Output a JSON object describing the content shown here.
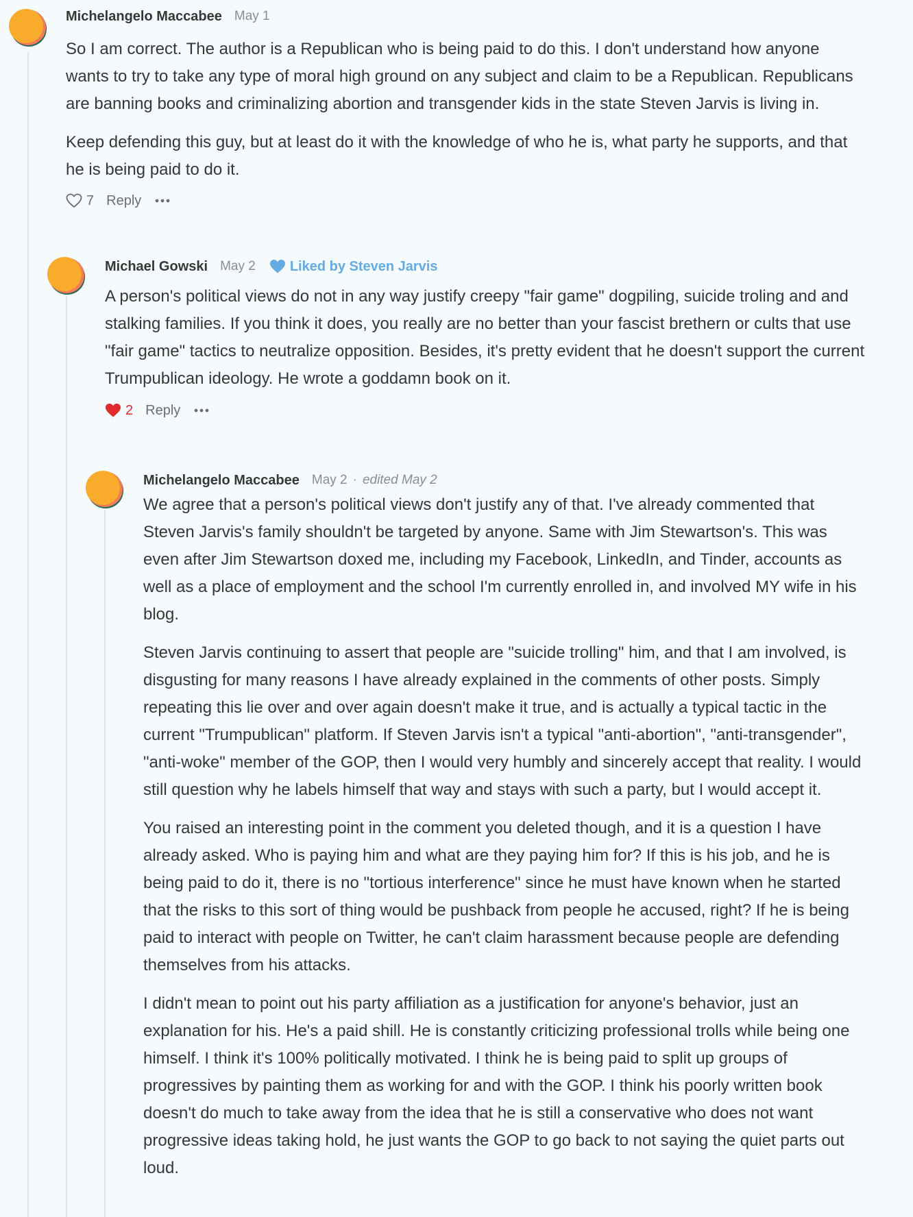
{
  "comments": [
    {
      "author": "Michelangelo Maccabee",
      "date": "May 1",
      "paragraphs": [
        "So I am correct. The author is a Republican who is being paid to do this. I don't understand how anyone wants to try to take any type of moral high ground on any subject and claim to be a Republican. Republicans are banning books and criminalizing abortion and transgender kids in the state Steven Jarvis is living in.",
        "Keep defending this guy, but at least do it with the knowledge of who he is, what party he supports, and that he is being paid to do it."
      ],
      "like_count": "7",
      "liked": false,
      "reply_label": "Reply",
      "more_icon": "ellipsis-icon"
    },
    {
      "author": "Michael Gowski",
      "date": "May 2",
      "liked_by": "Liked by Steven Jarvis",
      "paragraphs": [
        "A person's political views do not in any way justify creepy \"fair game\" dogpiling, suicide troling and and stalking families. If you think it does, you really are no better than your fascist brethern or cults that use \"fair game\" tactics to neutralize opposition. Besides, it's pretty evident that he doesn't support the current Trumpublican ideology. He wrote a goddamn book on it."
      ],
      "like_count": "2",
      "liked": true,
      "reply_label": "Reply",
      "more_icon": "ellipsis-icon"
    },
    {
      "author": "Michelangelo Maccabee",
      "date": "May 2",
      "separator": "·",
      "edited": "edited May 2",
      "paragraphs": [
        "We agree that a person's political views don't justify any of that. I've already commented that Steven Jarvis's family shouldn't be targeted by anyone. Same with Jim Stewartson's. This was even after Jim Stewartson doxed me, including my Facebook, LinkedIn, and Tinder, accounts as well as a place of employment and the school I'm currently enrolled in, and involved MY wife in his blog.",
        "Steven Jarvis continuing to assert that people are \"suicide trolling\" him, and that I am involved, is disgusting for many reasons I have already explained in the comments of other posts. Simply repeating this lie over and over again doesn't make it true, and is actually a typical tactic in the current \"Trumpublican\" platform. If Steven Jarvis isn't a typical \"anti-abortion\", \"anti-transgender\", \"anti-woke\" member of the GOP, then I would very humbly and sincerely accept that reality. I would still question why he labels himself that way and stays with such a party, but I would accept it.",
        "You raised an interesting point in the comment you deleted though, and it is a question I have already asked. Who is paying him and what are they paying him for? If this is his job, and he is being paid to do it, there is no \"tortious interference\" since he must have known when he started that the risks to this sort of thing would be pushback from people he accused, right? If he is being paid to interact with people on Twitter, he can't claim harassment because people are defending themselves from his attacks.",
        "I didn't mean to point out his party affiliation as a justification for anyone's behavior, just an explanation for his. He's a paid shill. He is constantly criticizing professional trolls while being one himself. I think it's 100% politically motivated. I think he is being paid to split up groups of progressives by painting them as working for and with the GOP. I think his poorly written book doesn't do much to take away from the idea that he is still a conservative who does not want progressive ideas taking hold, he just wants the GOP to go back to not saying the quiet parts out loud."
      ]
    }
  ],
  "colors": {
    "background": "#f5fafd",
    "text": "#363737",
    "muted": "#8a8e92",
    "liked_blue": "#64abe3",
    "heart_red": "#e02c2c",
    "avatar_orange": "#f9ac2b",
    "avatar_green": "#1e6b4f",
    "avatar_coral": "#f07a5a"
  }
}
